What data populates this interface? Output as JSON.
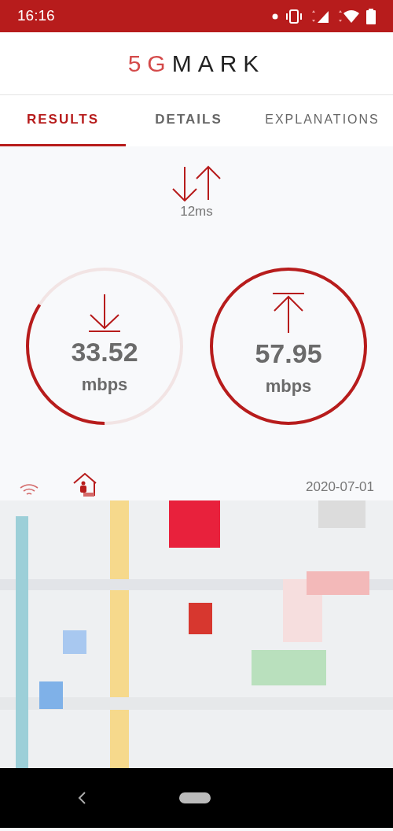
{
  "status_bar": {
    "time": "16:16"
  },
  "header": {
    "logo_accent": "5G",
    "logo_rest": "MARK"
  },
  "tabs": [
    {
      "label": "RESULTS",
      "selected": true
    },
    {
      "label": "DETAILS",
      "selected": false
    },
    {
      "label": "EXPLANATIONS",
      "selected": false
    }
  ],
  "latency": {
    "value": "12ms"
  },
  "gauges": [
    {
      "kind": "download",
      "value": "33.52",
      "unit": "mbps",
      "level": 0.34
    },
    {
      "kind": "upload",
      "value": "57.95",
      "unit": "mbps",
      "level": 1.0
    }
  ],
  "info": {
    "date": "2020-07-01"
  }
}
